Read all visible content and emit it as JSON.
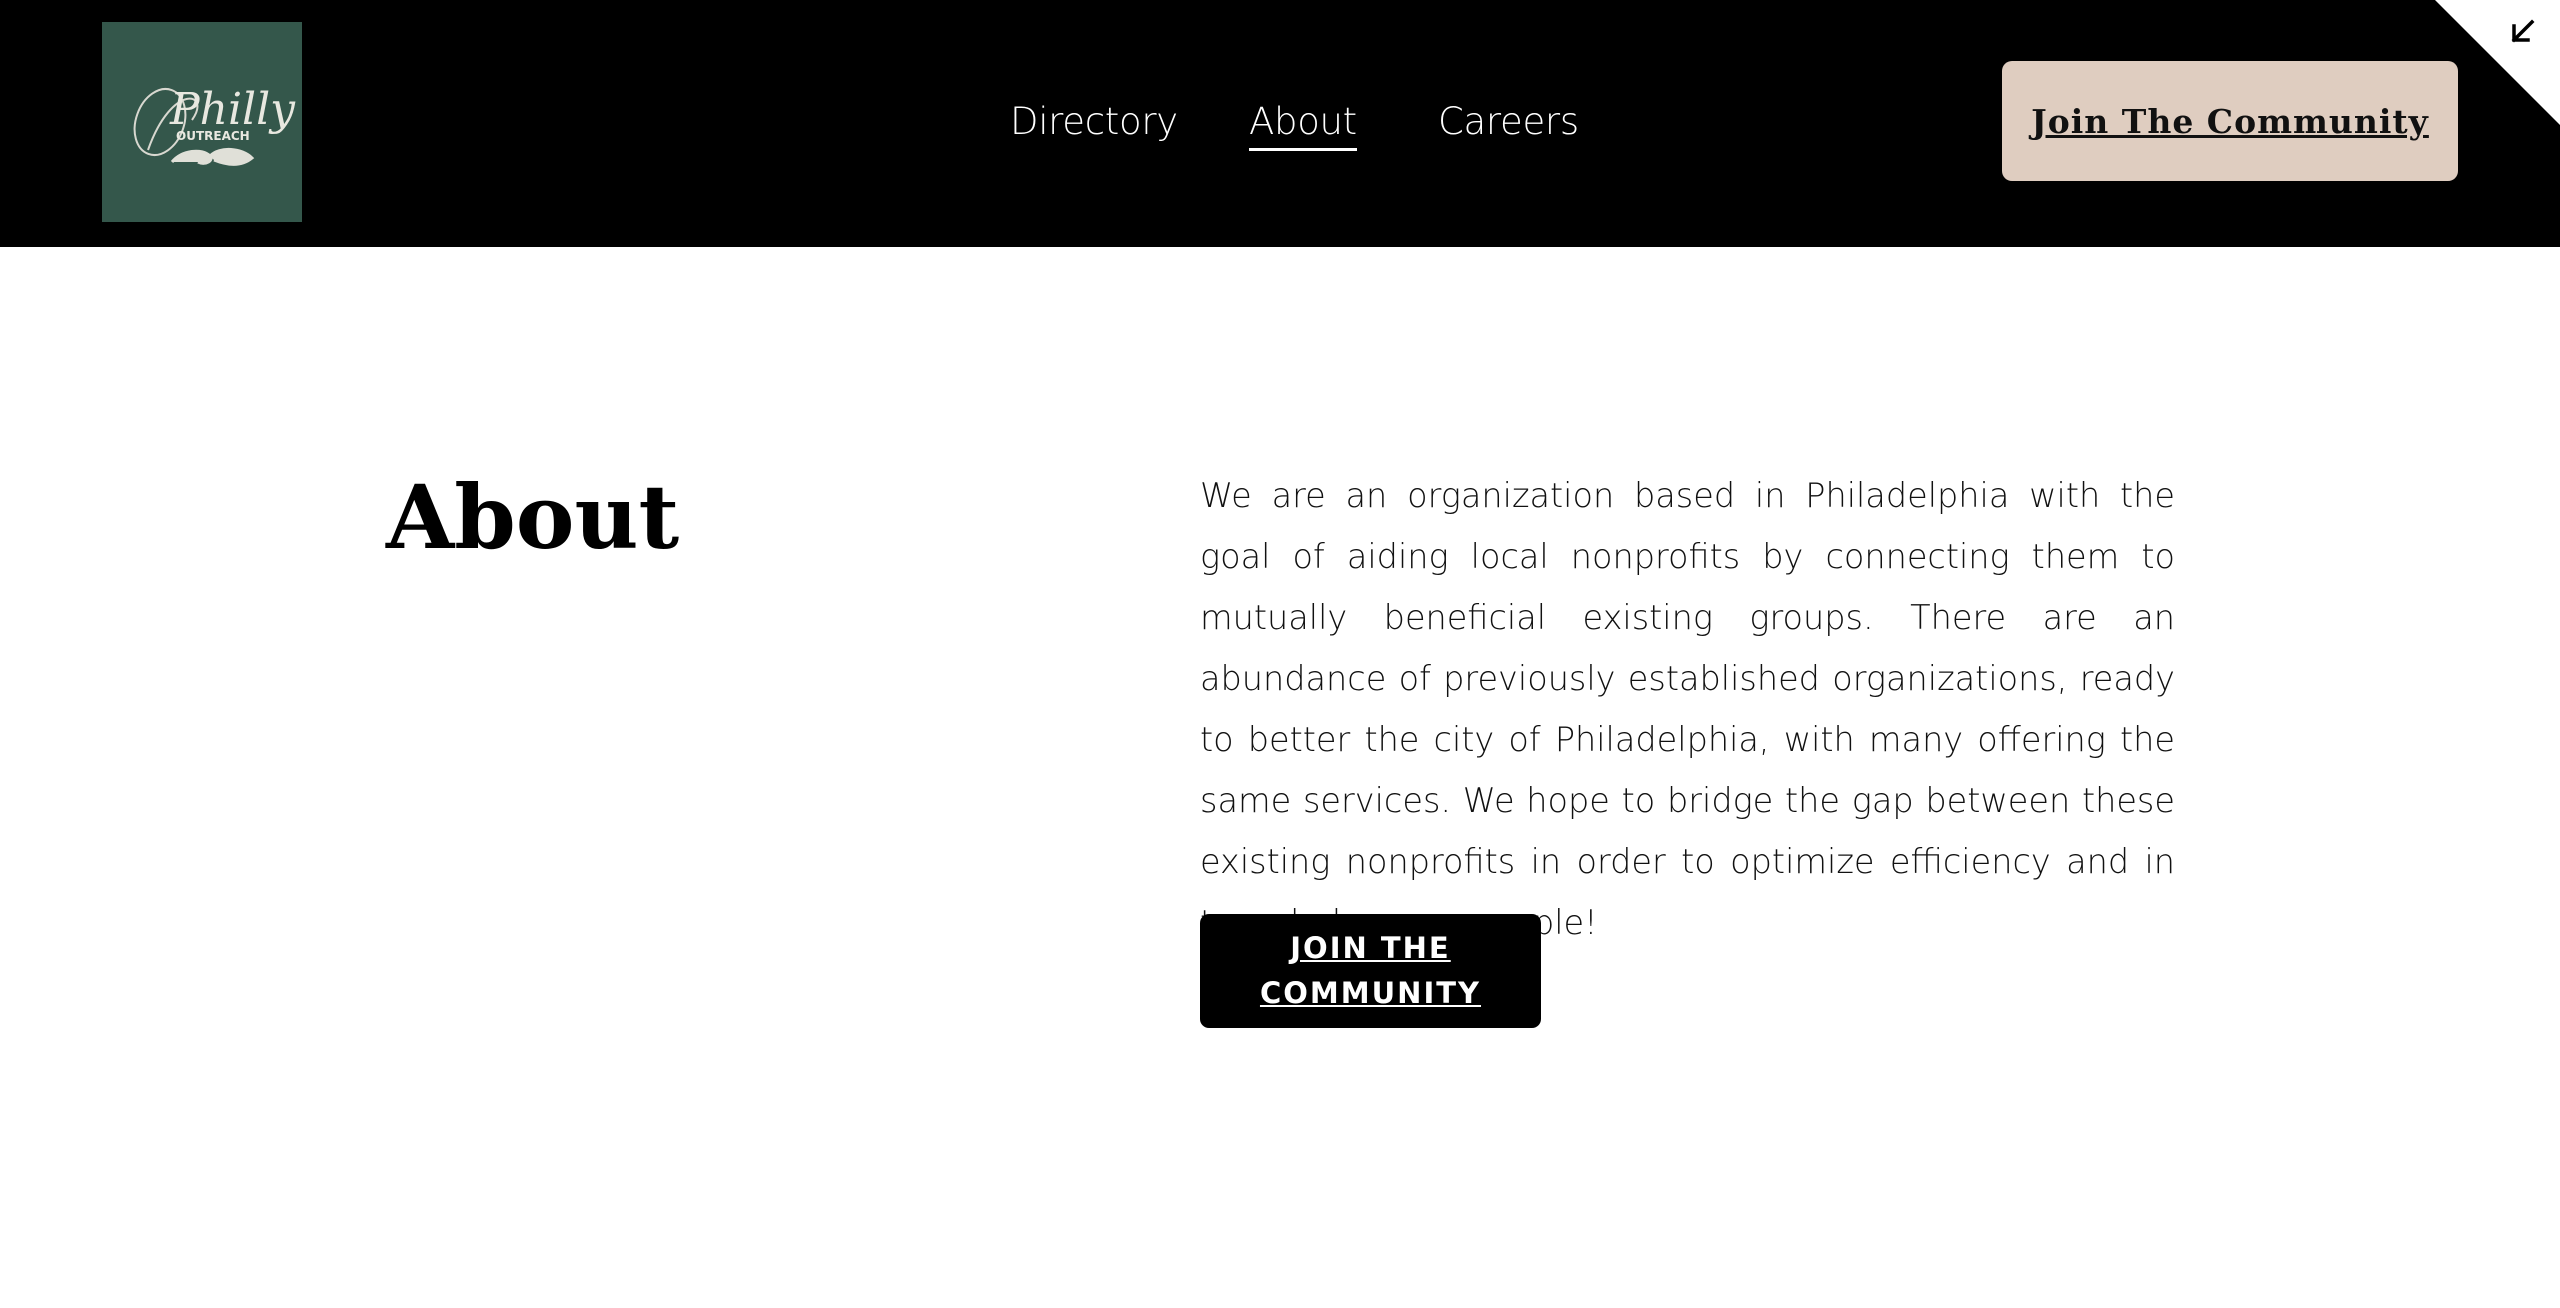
{
  "brand": {
    "logo_line1": "Philly",
    "logo_line2": "OUTREACH",
    "logo_bg": "#34574b"
  },
  "nav": {
    "items": [
      {
        "label": "Directory",
        "active": false
      },
      {
        "label": "About",
        "active": true
      },
      {
        "label": "Careers",
        "active": false
      }
    ]
  },
  "header": {
    "cta_label": "Join The Community",
    "cta_color": "#dfcdc0",
    "corner_icon": "collapse-arrow-icon"
  },
  "main": {
    "title": "About",
    "body": "We are an organization based in Philadelphia with the goal of aiding local nonprofits by connecting them to mutually beneficial existing groups. There are an abundance of previously established organizations, ready to better the city of Philadelphia, with many offering the same services. We hope to bridge the gap between these existing nonprofits in order to optimize efficiency and in turn, help more people!",
    "cta_label": "JOIN THE COMMUNITY"
  }
}
